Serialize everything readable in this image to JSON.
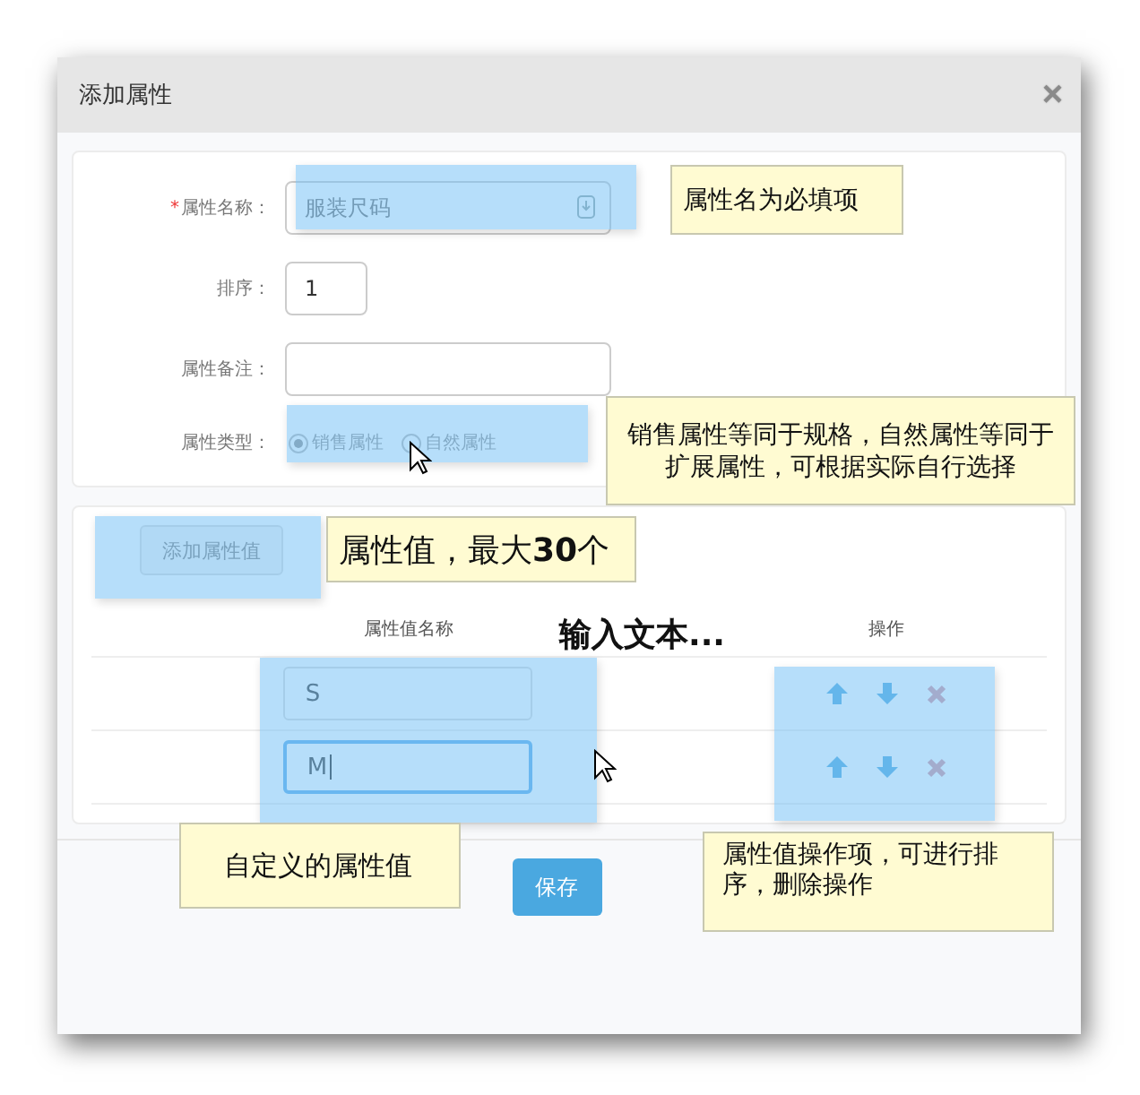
{
  "dialog": {
    "title": "添加属性",
    "close": "×"
  },
  "form": {
    "fields": [
      {
        "kind": "text",
        "label": "属性名称：",
        "required_mark": "*",
        "placeholder": "服装尺码",
        "spinner": true
      },
      {
        "kind": "number",
        "label": "排序：",
        "value": "1"
      },
      {
        "kind": "text",
        "label": "属性备注："
      },
      {
        "kind": "radio",
        "label": "属性类型：",
        "options": [
          {
            "label": "销售属性",
            "selected": true
          },
          {
            "label": "自然属性",
            "selected": false
          }
        ]
      }
    ]
  },
  "values": {
    "add_button": "添加属性值",
    "columns": [
      "属性值名称",
      "操作"
    ],
    "rows": [
      {
        "value": "S",
        "focused": false
      },
      {
        "value": "M",
        "focused": true
      }
    ]
  },
  "save_button": "保存",
  "annotations": [
    {
      "kind": "note",
      "text": "属性名为必填项"
    },
    {
      "kind": "note",
      "text": "销售属性等同于规格，自然属性等同于扩展属性，可根据实际自行选择"
    },
    {
      "kind": "note",
      "text": "属性值，最大**30**个"
    },
    {
      "kind": "label",
      "text": "输入文本..."
    },
    {
      "kind": "note",
      "text": "自定义的属性值"
    },
    {
      "kind": "note",
      "text": "属性值操作项，可进行排序，删除操作"
    }
  ]
}
